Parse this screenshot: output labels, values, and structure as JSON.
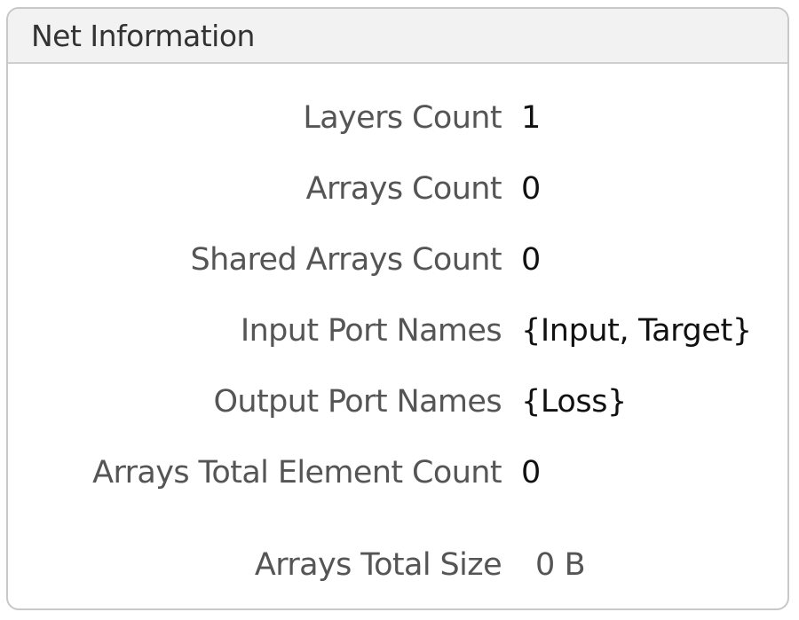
{
  "panel": {
    "title": "Net Information"
  },
  "rows": [
    {
      "label": "Layers Count",
      "value": "1"
    },
    {
      "label": "Arrays Count",
      "value": "0"
    },
    {
      "label": "Shared Arrays Count",
      "value": "0"
    },
    {
      "label": "Input Port Names",
      "value": "{Input, Target}"
    },
    {
      "label": "Output Port Names",
      "value": "{Loss}"
    },
    {
      "label": "Arrays Total Element Count",
      "value": "0"
    },
    {
      "label": "Arrays Total Size",
      "value": "0 B"
    }
  ]
}
